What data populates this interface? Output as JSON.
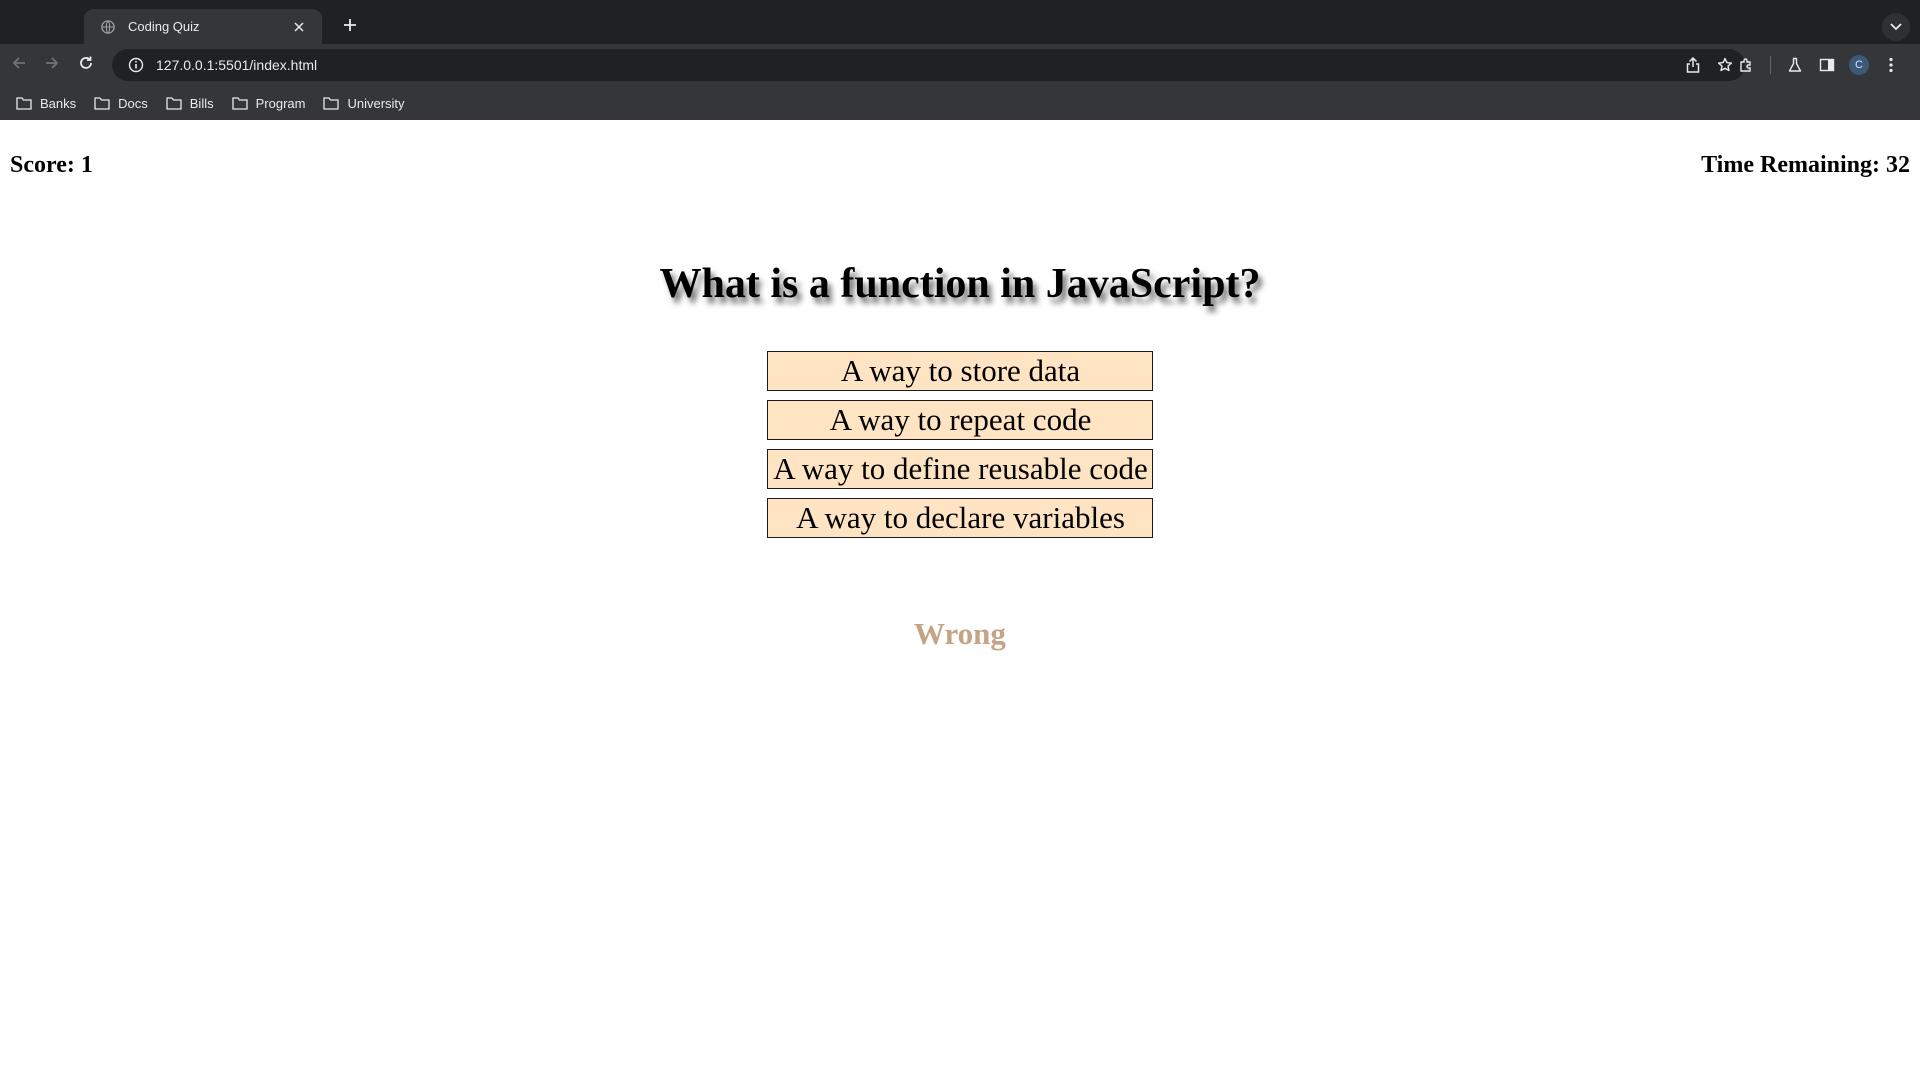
{
  "browser": {
    "tab": {
      "title": "Coding Quiz"
    },
    "address_bar": {
      "url": "127.0.0.1:5501/index.html"
    },
    "profile_initial": "C",
    "bookmarks": [
      {
        "label": "Banks"
      },
      {
        "label": "Docs"
      },
      {
        "label": "Bills"
      },
      {
        "label": "Program"
      },
      {
        "label": "University"
      }
    ]
  },
  "quiz": {
    "score_text": "Score: 1",
    "timer_text": "Time Remaining: 32",
    "question": "What is a function in JavaScript?",
    "answers": [
      {
        "label": "A way to store data"
      },
      {
        "label": "A way to repeat code"
      },
      {
        "label": "A way to define reusable code"
      },
      {
        "label": "A way to declare variables"
      }
    ],
    "feedback": "Wrong"
  },
  "colors": {
    "answer_background": "#ffe4c4",
    "feedback_text": "#c4a484",
    "chrome_dark": "#202124",
    "chrome_toolbar": "#35363a"
  }
}
